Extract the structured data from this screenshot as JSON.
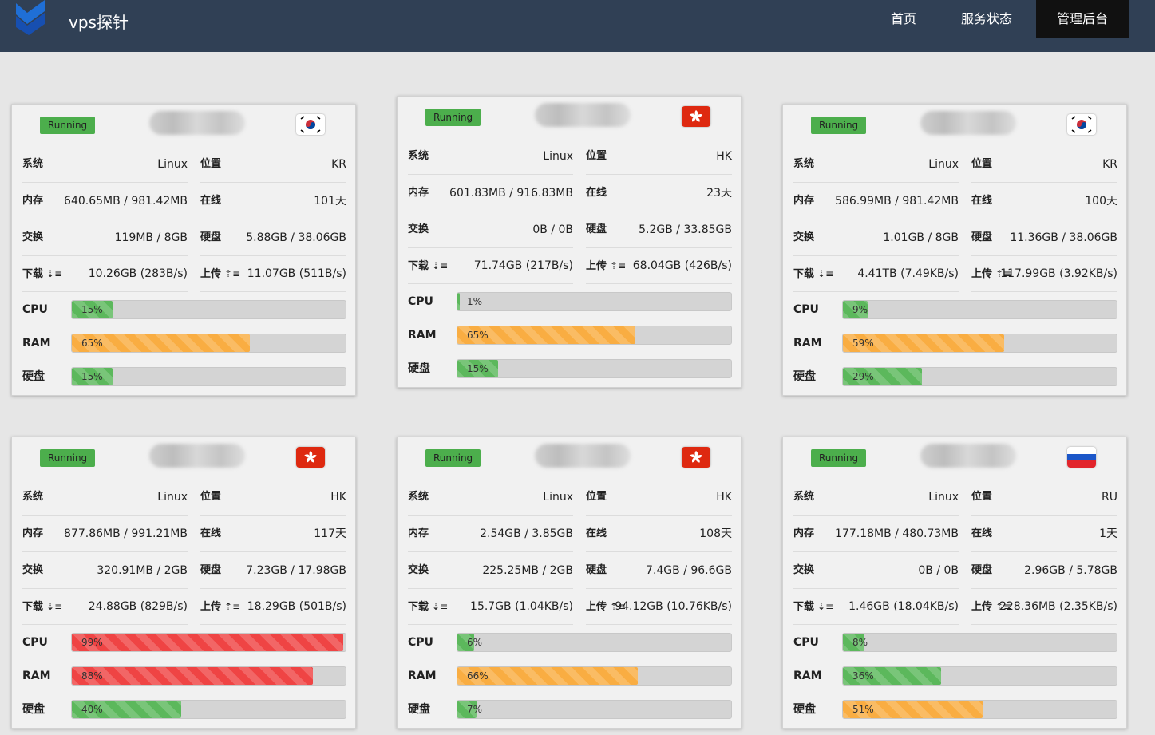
{
  "app": {
    "title": "vps探针"
  },
  "nav": [
    {
      "label": "首页"
    },
    {
      "label": "服务状态"
    },
    {
      "label": "管理后台"
    }
  ],
  "labels": {
    "os": "系统",
    "location": "位置",
    "memory": "内存",
    "online": "在线",
    "swap": "交换",
    "disk": "硬盘",
    "download": "下载",
    "upload": "上传",
    "cpu": "CPU",
    "ram": "RAM",
    "disk_bar": "硬盘",
    "download_icon": "⇣≡",
    "upload_icon": "⇡≡"
  },
  "colors": {
    "topbar": "#304055",
    "running": "#4cae4c",
    "green": "#5cb85c",
    "orange": "#f9ad42",
    "red": "#ef4444"
  },
  "servers": [
    {
      "status": "Running",
      "flag": "kr-flag-icon",
      "os": "Linux",
      "location": "KR",
      "memory": "640.65MB / 981.42MB",
      "online": "101天",
      "swap": "119MB / 8GB",
      "disk": "5.88GB / 38.06GB",
      "download": "10.26GB (283B/s)",
      "upload": "11.07GB (511B/s)",
      "cpu": "15%",
      "ram": "65%",
      "disk_pct": "15%",
      "cpu_val": 15,
      "ram_val": 65,
      "disk_val": 15
    },
    {
      "status": "Running",
      "flag": "hk-flag-icon",
      "os": "Linux",
      "location": "HK",
      "memory": "601.83MB / 916.83MB",
      "online": "23天",
      "swap": "0B / 0B",
      "disk": "5.2GB / 33.85GB",
      "download": "71.74GB (217B/s)",
      "upload": "68.04GB (426B/s)",
      "cpu": "1%",
      "ram": "65%",
      "disk_pct": "15%",
      "cpu_val": 1,
      "ram_val": 65,
      "disk_val": 15
    },
    {
      "status": "Running",
      "flag": "kr-flag-icon",
      "os": "Linux",
      "location": "KR",
      "memory": "586.99MB / 981.42MB",
      "online": "100天",
      "swap": "1.01GB / 8GB",
      "disk": "11.36GB / 38.06GB",
      "download": "4.41TB (7.49KB/s)",
      "upload": "117.99GB (3.92KB/s)",
      "cpu": "9%",
      "ram": "59%",
      "disk_pct": "29%",
      "cpu_val": 9,
      "ram_val": 59,
      "disk_val": 29
    },
    {
      "status": "Running",
      "flag": "hk-flag-icon",
      "os": "Linux",
      "location": "HK",
      "memory": "877.86MB / 991.21MB",
      "online": "117天",
      "swap": "320.91MB / 2GB",
      "disk": "7.23GB / 17.98GB",
      "download": "24.88GB (829B/s)",
      "upload": "18.29GB (501B/s)",
      "cpu": "99%",
      "ram": "88%",
      "disk_pct": "40%",
      "cpu_val": 99,
      "ram_val": 88,
      "disk_val": 40
    },
    {
      "status": "Running",
      "flag": "hk-flag-icon",
      "os": "Linux",
      "location": "HK",
      "memory": "2.54GB / 3.85GB",
      "online": "108天",
      "swap": "225.25MB / 2GB",
      "disk": "7.4GB / 96.6GB",
      "download": "15.7GB (1.04KB/s)",
      "upload": "94.12GB (10.76KB/s)",
      "cpu": "6%",
      "ram": "66%",
      "disk_pct": "7%",
      "cpu_val": 6,
      "ram_val": 66,
      "disk_val": 7
    },
    {
      "status": "Running",
      "flag": "ru-flag-icon",
      "os": "Linux",
      "location": "RU",
      "memory": "177.18MB / 480.73MB",
      "online": "1天",
      "swap": "0B / 0B",
      "disk": "2.96GB / 5.78GB",
      "download": "1.46GB (18.04KB/s)",
      "upload": "228.36MB (2.35KB/s)",
      "cpu": "8%",
      "ram": "36%",
      "disk_pct": "51%",
      "cpu_val": 8,
      "ram_val": 36,
      "disk_val": 51
    }
  ]
}
